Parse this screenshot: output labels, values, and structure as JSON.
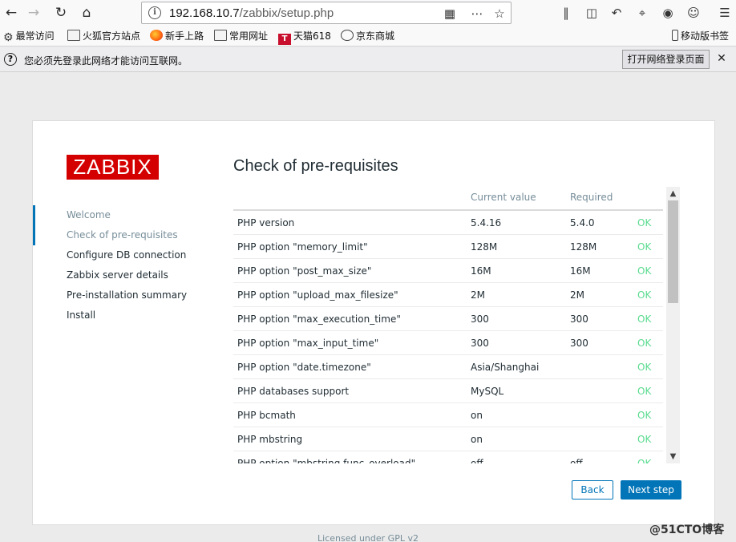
{
  "browser": {
    "url_host": "192.168.10.7",
    "url_path": "/zabbix/setup.php",
    "bookmarks": [
      {
        "label": "最常访问",
        "icon": "gear-icon"
      },
      {
        "label": "火狐官方站点",
        "icon": "folder-icon"
      },
      {
        "label": "新手上路",
        "icon": "firefox-icon"
      },
      {
        "label": "常用网址",
        "icon": "folder-icon"
      },
      {
        "label": "天猫618",
        "icon": "tmall-icon"
      },
      {
        "label": "京东商城",
        "icon": "globe-icon"
      }
    ],
    "mobile_bookmarks": "移动版书签",
    "tmall_glyph": "T"
  },
  "notification": {
    "message": "您必须先登录此网络才能访问互联网。",
    "button": "打开网络登录页面",
    "question_glyph": "?"
  },
  "zabbix": {
    "logo": "ZABBIX",
    "steps": [
      "Welcome",
      "Check of pre-requisites",
      "Configure DB connection",
      "Zabbix server details",
      "Pre-installation summary",
      "Install"
    ],
    "heading": "Check of pre-requisites",
    "columns": {
      "current": "Current value",
      "required": "Required"
    },
    "rows": [
      {
        "name": "PHP version",
        "current": "5.4.16",
        "required": "5.4.0",
        "status": "OK"
      },
      {
        "name": "PHP option \"memory_limit\"",
        "current": "128M",
        "required": "128M",
        "status": "OK"
      },
      {
        "name": "PHP option \"post_max_size\"",
        "current": "16M",
        "required": "16M",
        "status": "OK"
      },
      {
        "name": "PHP option \"upload_max_filesize\"",
        "current": "2M",
        "required": "2M",
        "status": "OK"
      },
      {
        "name": "PHP option \"max_execution_time\"",
        "current": "300",
        "required": "300",
        "status": "OK"
      },
      {
        "name": "PHP option \"max_input_time\"",
        "current": "300",
        "required": "300",
        "status": "OK"
      },
      {
        "name": "PHP option \"date.timezone\"",
        "current": "Asia/Shanghai",
        "required": "",
        "status": "OK"
      },
      {
        "name": "PHP databases support",
        "current": "MySQL",
        "required": "",
        "status": "OK"
      },
      {
        "name": "PHP bcmath",
        "current": "on",
        "required": "",
        "status": "OK"
      },
      {
        "name": "PHP mbstring",
        "current": "on",
        "required": "",
        "status": "OK"
      },
      {
        "name": "PHP option \"mbstring.func_overload\"",
        "current": "off",
        "required": "off",
        "status": "OK"
      }
    ],
    "back": "Back",
    "next": "Next step",
    "footer": "Licensed under GPL v2"
  },
  "watermark": "@51CTO博客",
  "colors": {
    "accent": "#0275b8",
    "logo": "#d40000",
    "ok": "#59db8f",
    "muted": "#768d99"
  }
}
